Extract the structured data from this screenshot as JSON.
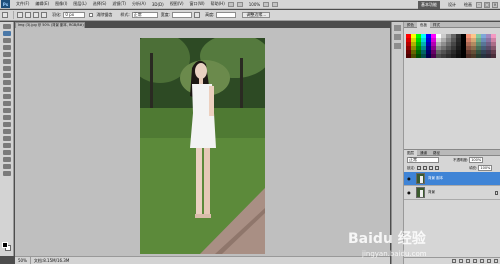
{
  "menubar": {
    "logo": "Ps",
    "items": [
      "文件(F)",
      "编辑(E)",
      "图像(I)",
      "图层(L)",
      "选择(S)",
      "滤镜(T)",
      "分析(A)",
      "3D(D)",
      "视图(V)",
      "窗口(W)",
      "帮助(H)"
    ],
    "zoom_value": "100%",
    "workspace_items": [
      "基本功能",
      "设计",
      "绘画"
    ],
    "active_workspace": "基本功能"
  },
  "options": {
    "feather_label": "羽化:",
    "feather_value": "0 px",
    "antialias_label": "消除锯齿",
    "style_label": "样式:",
    "style_value": "正常",
    "width_label": "宽度:",
    "height_label": "高度:",
    "refine_button": "调整边缘..."
  },
  "document": {
    "tab_title": "Img (3).jpg @ 50% (背景 副本, RGB/8#)",
    "zoom": "50%",
    "doc_info": "文档:8.15M/16.3M"
  },
  "panels": {
    "top_tabs": [
      "颜色",
      "色板",
      "样式"
    ],
    "active_top_tab": "色板",
    "layer_tabs": [
      "图层",
      "通道",
      "路径"
    ],
    "active_layer_tab": "图层",
    "blend_mode": "正常",
    "opacity_label": "不透明度:",
    "opacity_value": "100%",
    "lock_label": "锁定:",
    "fill_label": "填充:",
    "fill_value": "100%",
    "layers": [
      {
        "name": "背景 副本",
        "selected": true
      },
      {
        "name": "背景",
        "selected": false
      }
    ]
  },
  "watermark": {
    "brand": "Baidu 经验",
    "url": "jingyan.baidu.com"
  },
  "colors": {
    "selection": "#3f84d6",
    "canvas_bg": "#bfbfbf",
    "ui_gray": "#d6d6d6"
  }
}
